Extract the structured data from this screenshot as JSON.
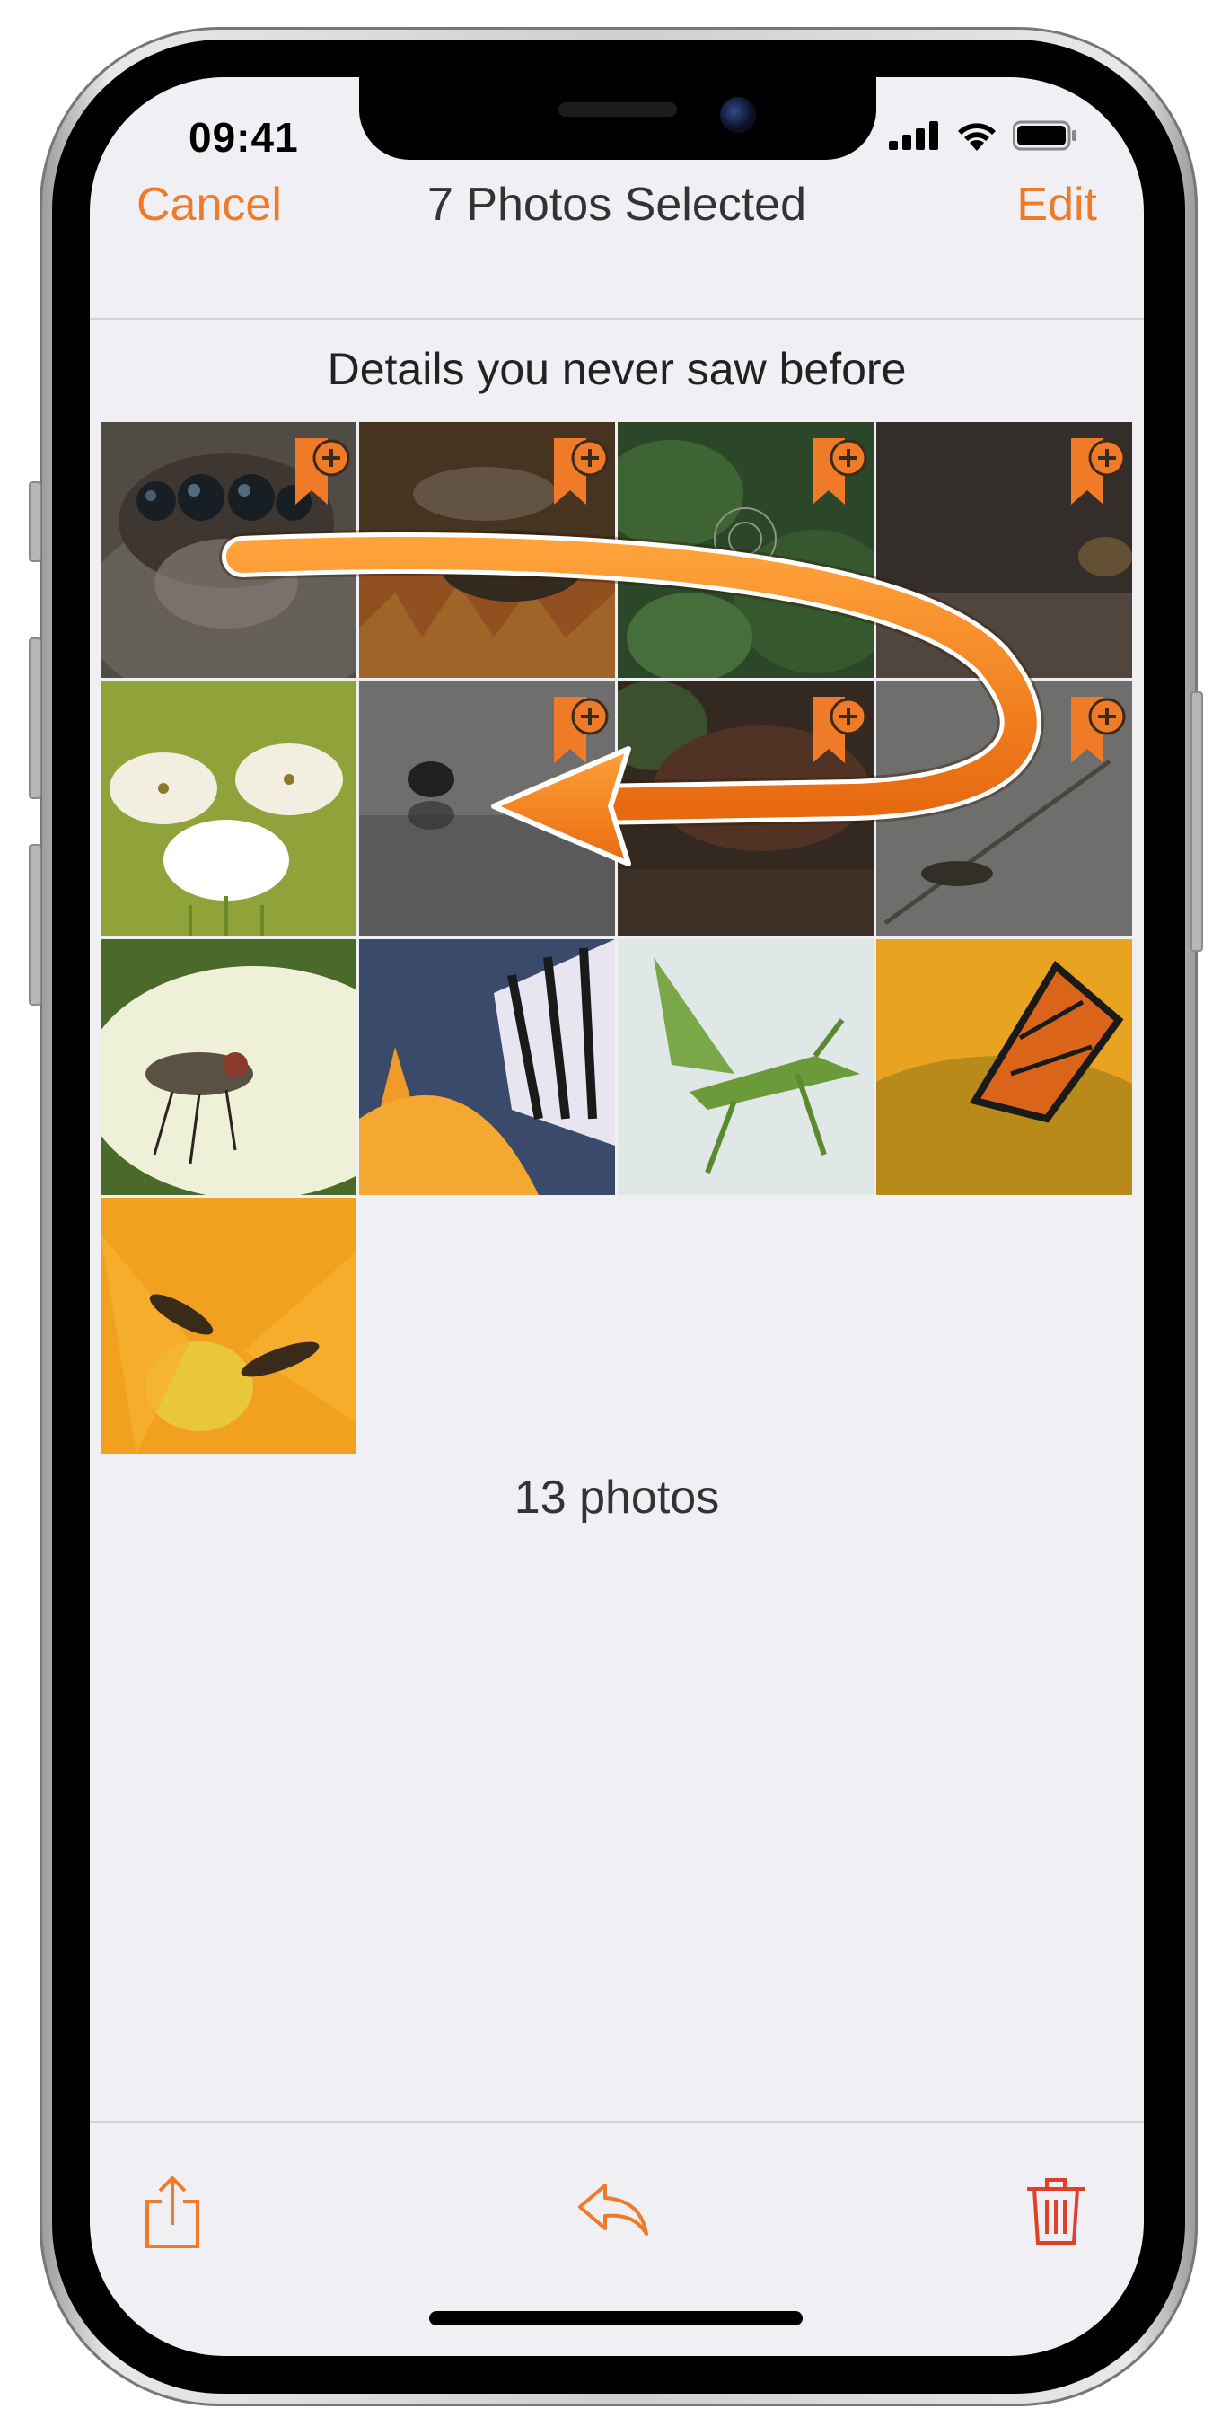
{
  "status_bar": {
    "time": "09:41"
  },
  "nav": {
    "cancel_label": "Cancel",
    "title": "7 Photos Selected",
    "edit_label": "Edit"
  },
  "album": {
    "title": "Details you never saw before",
    "photo_count_label": "13 photos"
  },
  "photos": [
    {
      "subject": "jumping spider eyes",
      "selected": true
    },
    {
      "subject": "bee on flower",
      "selected": true
    },
    {
      "subject": "spider web in leaves",
      "selected": true
    },
    {
      "subject": "small insect on surface",
      "selected": true
    },
    {
      "subject": "white flowers on green",
      "selected": false
    },
    {
      "subject": "spider reflection",
      "selected": true
    },
    {
      "subject": "tarantula on bark",
      "selected": true
    },
    {
      "subject": "mosquito on stem",
      "selected": true
    },
    {
      "subject": "fly on white petal",
      "selected": false
    },
    {
      "subject": "swallowtail butterfly on lily",
      "selected": false
    },
    {
      "subject": "praying mantis",
      "selected": false
    },
    {
      "subject": "monarch butterfly on sunflower",
      "selected": false
    },
    {
      "subject": "hoverflies on orange flower",
      "selected": false
    }
  ],
  "colors": {
    "accent": "#ef7a28",
    "trash": "#e0402a",
    "background": "#efeff4"
  },
  "toolbar": {
    "share_icon": "share-icon",
    "undo_icon": "undo-arrow-icon",
    "trash_icon": "trash-icon"
  }
}
